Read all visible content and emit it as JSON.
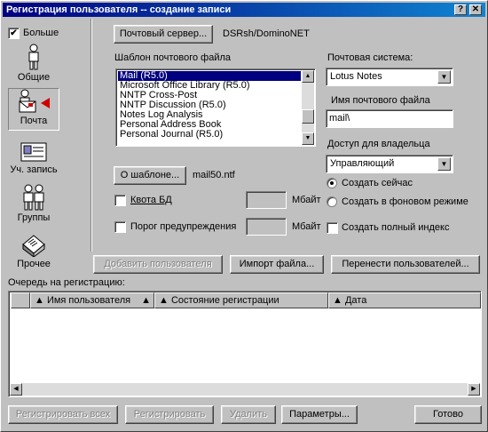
{
  "window": {
    "title": "Регистрация пользователя -- создание записи",
    "help_btn": "?",
    "close_btn": "✕"
  },
  "more_checkbox": {
    "label": "Больше",
    "checked": true
  },
  "nav": [
    {
      "label": "Общие",
      "icon": "person-icon"
    },
    {
      "label": "Почта",
      "icon": "mail-icon"
    },
    {
      "label": "Уч. запись",
      "icon": "account-icon"
    },
    {
      "label": "Группы",
      "icon": "group-icon"
    },
    {
      "label": "Прочее",
      "icon": "other-icon"
    }
  ],
  "mail": {
    "server_button": "Почтовый сервер...",
    "server_value": "DSRsh/DominoNET",
    "template_label": "Шаблон почтового файла",
    "templates": [
      "Mail (R5.0)",
      "Microsoft Office Library (R5.0)",
      "NNTP Cross-Post",
      "NNTP Discussion (R5.0)",
      "Notes Log Analysis",
      "Personal Address Book",
      "Personal Journal (R5.0)"
    ],
    "selected_template": "Mail (R5.0)",
    "about_button": "О шаблоне...",
    "template_file": "mail50.ntf",
    "quota_label": "Квота БД",
    "quota_unit": "Мбайт",
    "warn_label": "Порог предупреждения",
    "warn_unit": "Мбайт",
    "system_label": "Почтовая система:",
    "system_value": "Lotus Notes",
    "file_label": "Имя почтового файла",
    "file_value": "mail\\",
    "owner_access_label": "Доступ для владельца",
    "owner_access_value": "Управляющий",
    "create_now": "Создать сейчас",
    "create_bg": "Создать в фоновом режиме",
    "create_index": "Создать полный индекс"
  },
  "actions": {
    "add_user": "Добавить пользователя",
    "import_file": "Импорт файла...",
    "move_users": "Перенести пользователей..."
  },
  "queue": {
    "label": "Очередь на регистрацию:",
    "columns": [
      "Имя пользователя",
      "Состояние регистрации",
      "Дата"
    ]
  },
  "footer": {
    "register_all": "Регистрировать всех",
    "register": "Регистрировать",
    "delete": "Удалить",
    "params": "Параметры...",
    "done": "Готово"
  }
}
